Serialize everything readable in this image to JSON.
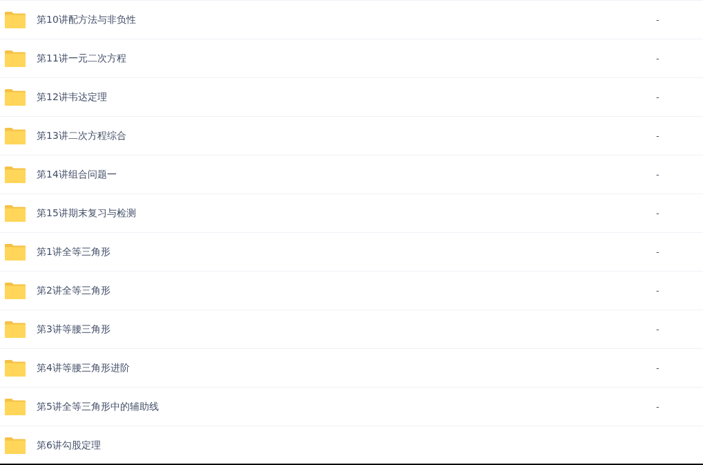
{
  "files": [
    {
      "name": "第10讲配方法与非负性",
      "size": "-"
    },
    {
      "name": "第11讲一元二次方程",
      "size": "-"
    },
    {
      "name": "第12讲韦达定理",
      "size": "-"
    },
    {
      "name": "第13讲二次方程综合",
      "size": "-"
    },
    {
      "name": "第14讲组合问题一",
      "size": "-"
    },
    {
      "name": "第15讲期末复习与检测",
      "size": "-"
    },
    {
      "name": "第1讲全等三角形",
      "size": "-"
    },
    {
      "name": "第2讲全等三角形",
      "size": "-"
    },
    {
      "name": "第3讲等腰三角形",
      "size": "-"
    },
    {
      "name": "第4讲等腰三角形进阶",
      "size": "-"
    },
    {
      "name": "第5讲全等三角形中的辅助线",
      "size": "-"
    },
    {
      "name": "第6讲勾股定理"
    }
  ]
}
